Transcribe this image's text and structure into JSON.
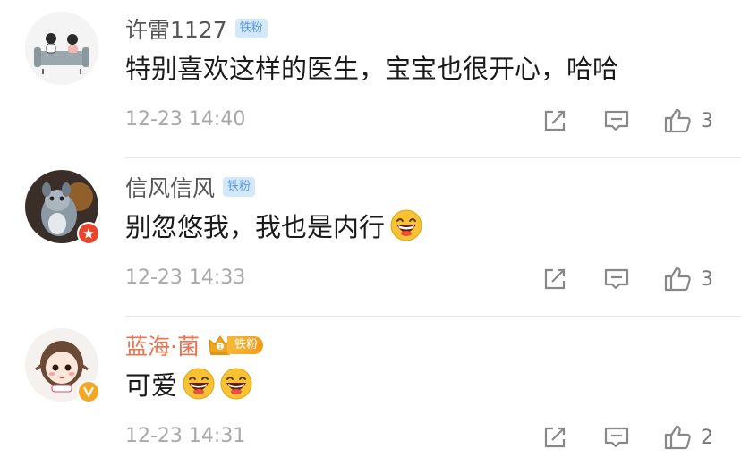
{
  "comments": [
    {
      "username": "许雷1127",
      "badge": "铁粉",
      "text": "特别喜欢这样的医生，宝宝也很开心，哈哈",
      "time": "12-23 14:40",
      "likes": "3",
      "avatar_icon": "couple-illustration-avatar"
    },
    {
      "username": "信风信风",
      "badge": "铁粉",
      "text": "别忽悠我，我也是内行",
      "emoji": [
        "laughing-emoji"
      ],
      "time": "12-23 14:33",
      "likes": "3",
      "avatar_icon": "plush-animal-avatar",
      "avatar_badge_color": "#e8452c"
    },
    {
      "username": "蓝海·菌",
      "badge": "铁粉",
      "text": "可爱",
      "emoji": [
        "laughing-emoji",
        "laughing-emoji"
      ],
      "time": "12-23 14:31",
      "likes": "2",
      "avatar_icon": "cartoon-girl-avatar",
      "avatar_badge_color": "#f5a623",
      "name_color": "#eb7350"
    }
  ],
  "icons": {
    "repost": "repost-icon",
    "reply": "comment-icon",
    "like": "thumbs-up-icon"
  },
  "colors": {
    "fan_badge_bg": "#d3e8fb",
    "fan_badge_text": "#5b9be0",
    "timestamp": "#a8a8a8",
    "vip_name": "#eb7350"
  }
}
